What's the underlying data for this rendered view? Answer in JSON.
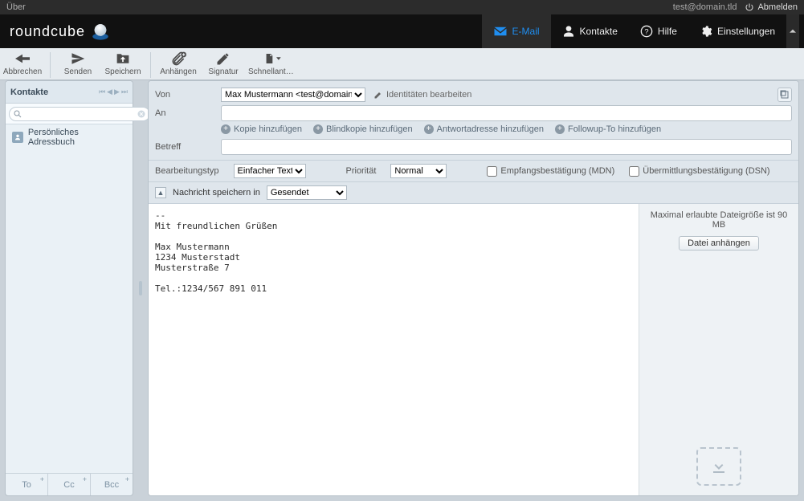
{
  "topbar": {
    "about": "Über",
    "user": "test@domain.tld",
    "logout": "Abmelden"
  },
  "brand": "roundcube",
  "nav": {
    "email": "E-Mail",
    "contacts": "Kontakte",
    "help": "Hilfe",
    "settings": "Einstellungen"
  },
  "toolbar": {
    "cancel": "Abbrechen",
    "send": "Senden",
    "save": "Speichern",
    "attach": "Anhängen",
    "signature": "Signatur",
    "responses": "Schnellantw..."
  },
  "sidebar": {
    "title": "Kontakte",
    "search_placeholder": "",
    "addressbook": "Persönliches Adressbuch",
    "foot": {
      "to": "To",
      "cc": "Cc",
      "bcc": "Bcc"
    }
  },
  "compose": {
    "labels": {
      "from": "Von",
      "to": "An",
      "subject": "Betreff",
      "editortype": "Bearbeitungstyp",
      "priority": "Priorität",
      "savein": "Nachricht speichern in"
    },
    "from_selected": "Max Mustermann <test@domain.tld>",
    "identities_edit": "Identitäten bearbeiten",
    "addlinks": {
      "cc": "Kopie hinzufügen",
      "bcc": "Blindkopie hinzufügen",
      "replyto": "Antwortadresse hinzufügen",
      "followup": "Followup-To hinzufügen"
    },
    "editortype_selected": "Einfacher Text",
    "priority_selected": "Normal",
    "mdn_label": "Empfangsbestätigung (MDN)",
    "dsn_label": "Übermittlungsbestätigung (DSN)",
    "savein_selected": "Gesendet",
    "body": "--\nMit freundlichen Grüßen\n\nMax Mustermann\n1234 Musterstadt\nMusterstraße 7\n\nTel.:1234/567 891 011",
    "attach": {
      "maxsize": "Maximal erlaubte Dateigröße ist 90 MB",
      "button": "Datei anhängen"
    }
  }
}
